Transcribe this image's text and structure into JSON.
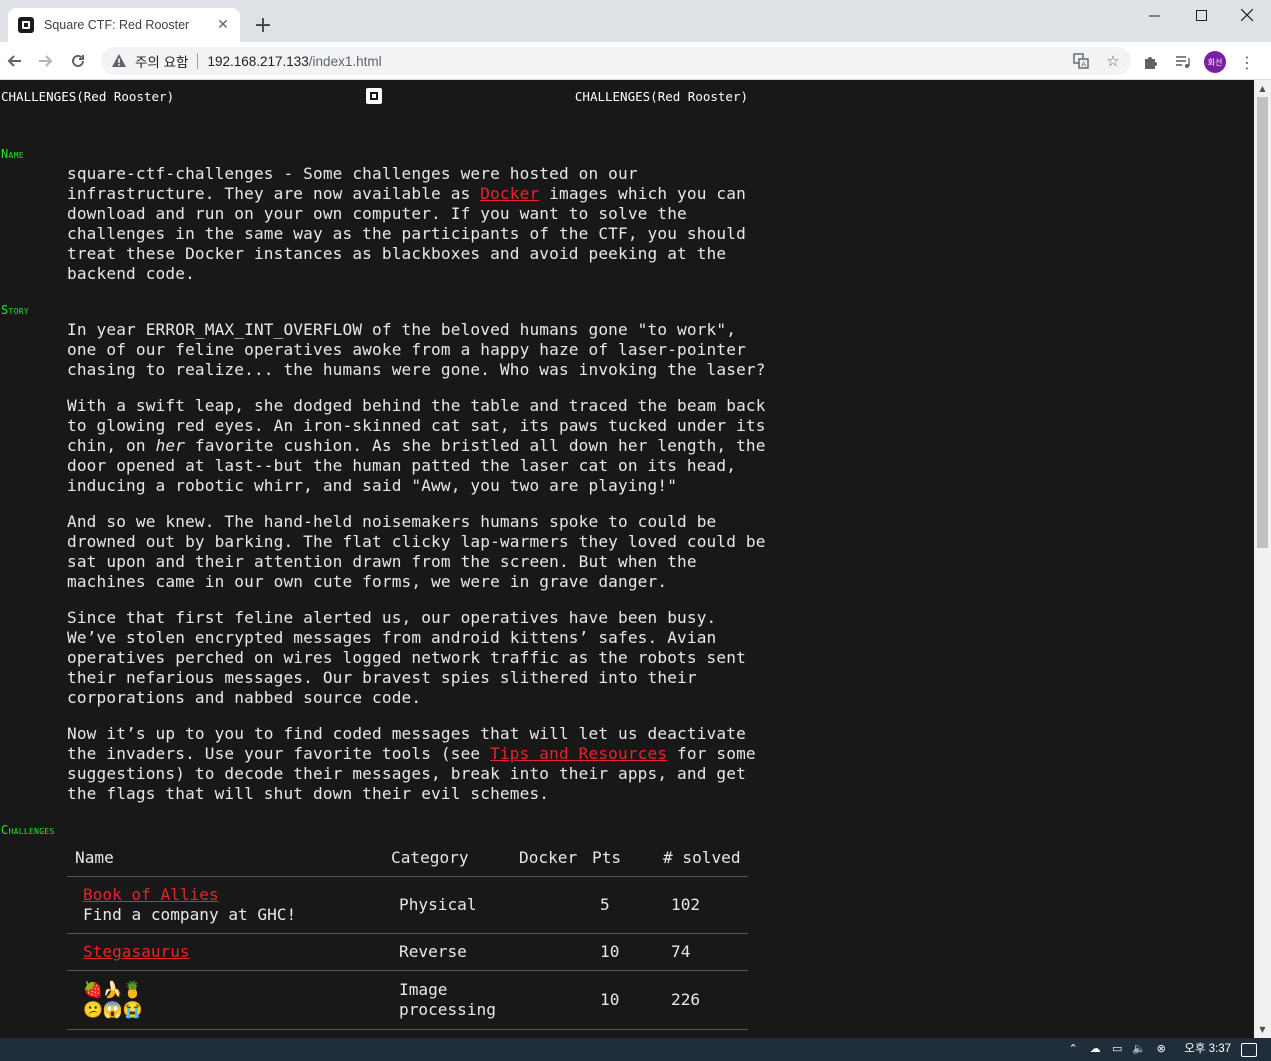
{
  "browser": {
    "tab_title": "Square CTF: Red Rooster",
    "security_label": "주의 요함",
    "url_host": "192.168.217.133",
    "url_path": "/index1.html",
    "profile_label": "회선"
  },
  "page": {
    "header_left": "CHALLENGES(Red Rooster)",
    "header_right": "CHALLENGES(Red Rooster)",
    "sections": {
      "name": "Name",
      "story": "Story",
      "challenges": "Challenges"
    },
    "name_para": {
      "l1": "square-ctf-challenges - Some challenges were hosted on our",
      "l2_pre": "infrastructure. They are now available as ",
      "l2_link": "Docker",
      "l2_post": " images which you can",
      "l3": "download and run on your own computer. If you want to solve the",
      "l4": "challenges in the same way as the participants of the CTF, you should",
      "l5": "treat these Docker instances as blackboxes and avoid peeking at the",
      "l6": "backend code."
    },
    "story_p1": "In year ERROR_MAX_INT_OVERFLOW of the beloved humans gone \"to work\",\none of our feline operatives awoke from a happy haze of laser-pointer\nchasing to realize... the humans were gone. Who was invoking the laser?",
    "story_p2": {
      "l1": "With a swift leap, she dodged behind the table and traced the beam back",
      "l2": "to glowing red eyes. An iron-skinned cat sat, its paws tucked under its",
      "l3_pre": "chin, on ",
      "l3_em": "her",
      "l3_post": " favorite cushion. As she bristled all down her length, the",
      "l4": "door opened at last--but the human patted the laser cat on its head,",
      "l5": "inducing a robotic whirr, and said \"Aww, you two are playing!\""
    },
    "story_p3": "And so we knew. The hand-held noisemakers humans spoke to could be\ndrowned out by barking. The flat clicky lap-warmers they loved could be\nsat upon and their attention drawn from the screen. But when the\nmachines came in our own cute forms, we were in grave danger.",
    "story_p4": "Since that first feline alerted us, our operatives have been busy.\nWe’ve stolen encrypted messages from android kittens’ safes. Avian\noperatives perched on wires logged network traffic as the robots sent\ntheir nefarious messages. Our bravest spies slithered into their\ncorporations and nabbed source code.",
    "story_p5": {
      "l1": "Now it’s up to you to find coded messages that will let us deactivate",
      "l2_pre": "the invaders. Use your favorite tools (see ",
      "l2_link": "Tips and Resources",
      "l2_post": " for some",
      "l3": "suggestions) to decode their messages, break into their apps, and get",
      "l4": "the flags that will shut down their evil schemes."
    },
    "table": {
      "headers": {
        "name": "Name",
        "category": "Category",
        "docker": "Docker",
        "pts": "Pts",
        "solved": "# solved"
      },
      "rows": [
        {
          "name": "Book of Allies",
          "desc": "Find a company at GHC!",
          "category": "Physical",
          "pts": "5",
          "solved": "102"
        },
        {
          "name": "Stegasaurus",
          "desc": "",
          "category": "Reverse",
          "pts": "10",
          "solved": "74"
        },
        {
          "name": "🍓🍌🍍",
          "desc": "😕😱😭",
          "category": "Image\nprocessing",
          "pts": "10",
          "solved": "226"
        }
      ]
    }
  },
  "taskbar": {
    "clock": "오후 3:37"
  },
  "colors": {
    "page_bg": "#181818",
    "section_green": "#29e628",
    "link_red": "#e5242c"
  }
}
